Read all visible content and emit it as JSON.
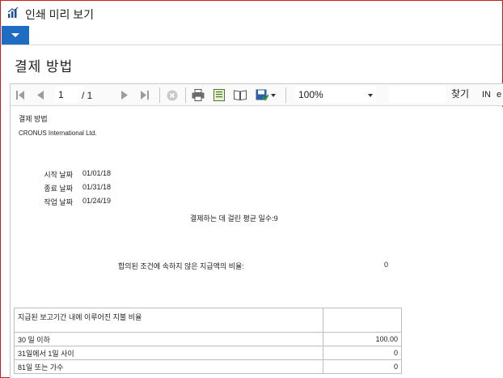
{
  "window": {
    "title": "인쇄 미리 보기"
  },
  "ribbon": {
    "menu_icon": "chevron-down-icon"
  },
  "page": {
    "title": "결제 방법"
  },
  "toolbar": {
    "current_page": "1",
    "total_pages": "/ 1",
    "zoom": "100%",
    "find_label": "찾기",
    "find_in": "IN",
    "find_next": "e"
  },
  "report": {
    "heading": "결제 방법",
    "company": "CRONUS International Ltd.",
    "start_date_label": "시작 날짜",
    "start_date": "01/01/18",
    "end_date_label": "종료 날짜",
    "end_date": "01/31/18",
    "work_date_label": "작업 날짜",
    "work_date": "01/24/19",
    "avg_days_text": "결제하는 데 걸린 평균 일수:",
    "avg_days_value": "9",
    "not_within_terms_label": "합의된 조건에 속하지 않은 지급액의 비율:",
    "not_within_terms_value": "0",
    "table": {
      "header": "지급된 보고기간 내에 이루어진 지불 비율",
      "rows": [
        {
          "label": "30 일 이하",
          "value": "100.00"
        },
        {
          "label": "31일에서 1일 사이",
          "value": "0"
        },
        {
          "label": "81일 또는 가수",
          "value": "0"
        }
      ]
    }
  }
}
